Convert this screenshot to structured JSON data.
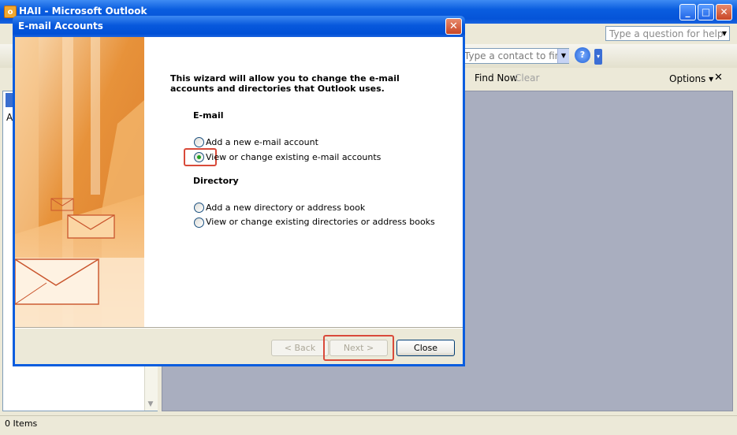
{
  "app": {
    "title": "HAII - Microsoft Outlook",
    "icon_letter": "o",
    "help_placeholder": "Type a question for help",
    "contact_placeholder": "Type a contact to find",
    "find_now": "Find Now",
    "clear": "Clear",
    "options": "Options",
    "left_header_letter": "A",
    "status": "0 Items"
  },
  "dialog": {
    "title": "E-mail Accounts",
    "intro": "This wizard will allow you to change the e-mail accounts and directories that Outlook uses.",
    "email_section": "E-mail",
    "email_options": [
      {
        "label": "Add a new e-mail account",
        "selected": false
      },
      {
        "label": "View or change existing e-mail accounts",
        "selected": true
      }
    ],
    "directory_section": "Directory",
    "directory_options": [
      {
        "label": "Add a new directory or address book",
        "selected": false
      },
      {
        "label": "View or change existing directories or address books",
        "selected": false
      }
    ],
    "buttons": {
      "back": "< Back",
      "next": "Next >",
      "close": "Close"
    }
  },
  "colors": {
    "accent": "#0a5ddf",
    "highlight": "#d94a3a"
  }
}
